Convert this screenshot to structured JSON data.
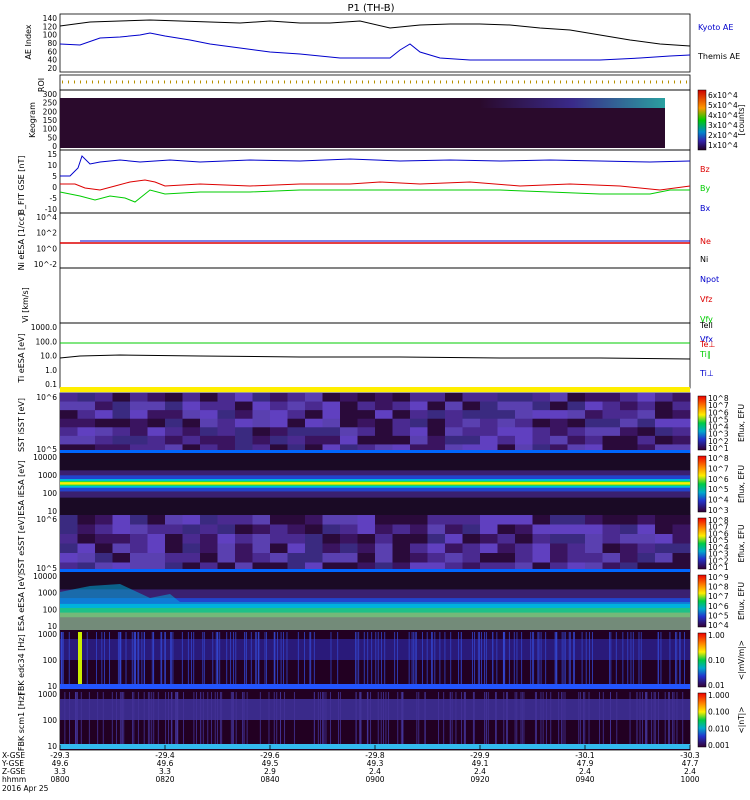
{
  "title": "P1 (TH-B)",
  "colors": {
    "black": "#000000",
    "blue": "#0000cc",
    "red": "#dd0000",
    "green": "#00cc00",
    "purple": "#5c1070",
    "yellow": "#ffee00"
  },
  "panels": [
    {
      "id": "ae",
      "ylabel": "AE Index",
      "yticks": [
        "140",
        "120",
        "100",
        "80",
        "60",
        "40",
        "20"
      ],
      "legend": [
        "Kyoto AE",
        "Themis AE"
      ]
    },
    {
      "id": "roi",
      "ylabel": "ROI"
    },
    {
      "id": "keogram",
      "ylabel": "Keogram",
      "yticks": [
        "300",
        "250",
        "200",
        "150",
        "100",
        "50",
        "0"
      ],
      "cb_ticks": [
        "6x10^4",
        "5x10^4",
        "4x10^4",
        "3x10^4",
        "2x10^4",
        "1x10^4"
      ],
      "cb_unit": "[counts]"
    },
    {
      "id": "bfit",
      "ylabel": "B_FIT GSE [nT]",
      "yticks": [
        "15",
        "10",
        "5",
        "0",
        "-5",
        "-10"
      ],
      "legend": [
        "Bz",
        "By",
        "Bx"
      ]
    },
    {
      "id": "ni",
      "ylabel": "Ni eESA [1/cc]",
      "yticks": [
        "10^4",
        "10^2",
        "10^0",
        "10^-2"
      ],
      "legend": [
        "Ne",
        "Ni",
        "Npot"
      ]
    },
    {
      "id": "vi",
      "ylabel": "Vi [km/s]",
      "legend": [
        "Vfz",
        "Vfy",
        "Vfx"
      ]
    },
    {
      "id": "ti",
      "ylabel": "Ti eESA [eV]",
      "yticks": [
        "1000.0",
        "100.0",
        "10.0",
        "1.0",
        "0.1"
      ],
      "legend": [
        "Tell",
        "Te⊥",
        "Ti∥",
        "Ti⊥"
      ]
    },
    {
      "id": "sst_i",
      "ylabel": "SST iSST [eV]",
      "yticks": [
        "10^6",
        "10^5"
      ],
      "cb_ticks": [
        "10^8",
        "10^7",
        "10^6",
        "10^5",
        "10^4",
        "10^3",
        "10^2",
        "10^1"
      ],
      "cb_unit": "Eflux, EFU"
    },
    {
      "id": "esa_i",
      "ylabel": "ESA iESA [eV]",
      "yticks": [
        "10000",
        "1000",
        "100",
        "10"
      ],
      "cb_ticks": [
        "10^8",
        "10^7",
        "10^6",
        "10^5",
        "10^4",
        "10^3"
      ],
      "cb_unit": "Eflux, EFU"
    },
    {
      "id": "sst_e",
      "ylabel": "SST eSST [eV]",
      "yticks": [
        "10^6",
        "10^5"
      ],
      "cb_ticks": [
        "10^8",
        "10^7",
        "10^6",
        "10^5",
        "10^4",
        "10^3",
        "10^2",
        "10^1"
      ],
      "cb_unit": "Eflux, EFU"
    },
    {
      "id": "esa_e",
      "ylabel": "ESA eESA [eV]",
      "yticks": [
        "10000",
        "1000",
        "100",
        "10"
      ],
      "cb_ticks": [
        "10^9",
        "10^8",
        "10^7",
        "10^6",
        "10^5",
        "10^4"
      ],
      "cb_unit": "Eflux, EFU"
    },
    {
      "id": "fbk1",
      "ylabel": "FBK edc34 [Hz]",
      "yticks": [
        "1000",
        "100",
        "10"
      ],
      "cb_ticks": [
        "1.00",
        "0.10",
        "0.01"
      ],
      "cb_unit": "<|mV/m|>"
    },
    {
      "id": "fbk2",
      "ylabel": "FBK scm1 [Hz]",
      "yticks": [
        "1000",
        "100",
        "10"
      ],
      "cb_ticks": [
        "1.000",
        "0.100",
        "0.010",
        "0.001"
      ],
      "cb_unit": "<|nT|>"
    }
  ],
  "xaxis": {
    "row_labels": [
      "X-GSE",
      "Y-GSE",
      "Z-GSE",
      "hhmm",
      "2016 Apr 25"
    ],
    "columns": [
      {
        "x": "-29.3",
        "y": "49.6",
        "z": "3.3",
        "t": "0800"
      },
      {
        "x": "-29.4",
        "y": "49.6",
        "z": "3.3",
        "t": "0820"
      },
      {
        "x": "-29.6",
        "y": "49.5",
        "z": "2.9",
        "t": "0840"
      },
      {
        "x": "-29.8",
        "y": "49.3",
        "z": "2.4",
        "t": "0900"
      },
      {
        "x": "-29.9",
        "y": "49.1",
        "z": "2.4",
        "t": "0920"
      },
      {
        "x": "-30.1",
        "y": "47.9",
        "z": "2.4",
        "t": "0940"
      },
      {
        "x": "-30.3",
        "y": "47.7",
        "z": "2.4",
        "t": "1000"
      }
    ]
  },
  "chart_data": {
    "type": "line",
    "title": "P1 (TH-B)",
    "x": [
      "0800",
      "0820",
      "0840",
      "0900",
      "0920",
      "0940",
      "1000"
    ],
    "series": [
      {
        "name": "Kyoto AE",
        "values": [
          118,
          126,
          124,
          118,
          116,
          104,
          92
        ]
      },
      {
        "name": "Themis AE",
        "values": [
          62,
          80,
          58,
          40,
          32,
          30,
          40
        ]
      },
      {
        "name": "Bz",
        "values": [
          -2,
          0,
          -3,
          -1,
          -2,
          -3,
          -2
        ]
      },
      {
        "name": "By",
        "values": [
          -6,
          -9,
          -6,
          -5,
          -6,
          -8,
          -4
        ]
      },
      {
        "name": "Bx",
        "values": [
          6,
          9,
          9,
          9,
          9,
          9,
          8
        ]
      },
      {
        "name": "Te⊥",
        "values": [
          500,
          500,
          500,
          500,
          500,
          500,
          500
        ]
      },
      {
        "name": "Ti∥",
        "values": [
          15,
          14,
          13,
          13,
          13,
          13,
          12
        ]
      }
    ],
    "ylim_ae": [
      0,
      150
    ],
    "ylim_b": [
      -10,
      15
    ]
  }
}
